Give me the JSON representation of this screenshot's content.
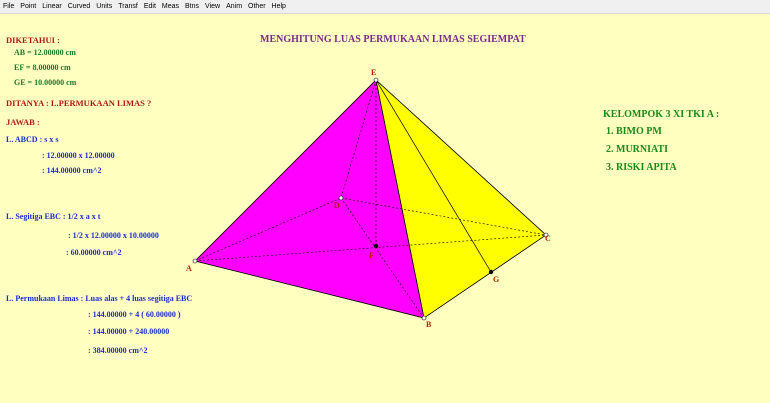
{
  "menu": [
    "File",
    "Point",
    "Linear",
    "Curved",
    "Units",
    "Transf",
    "Edit",
    "Meas",
    "Btns",
    "View",
    "Anim",
    "Other",
    "Help"
  ],
  "title": "MENGHITUNG LUAS PERMUKAAN LIMAS SEGIEMPAT",
  "diketahui": {
    "heading": "DIKETAHUI :",
    "ab": "AB = 12.00000  cm",
    "ef": "EF = 8.00000  cm",
    "ge": "GE = 10.00000  cm"
  },
  "ditanya": "DITANYA : L.PERMUKAAN LIMAS ?",
  "jawab": "JAWAB :",
  "abcd": {
    "label": "L. ABCD : s x s",
    "line1": ": 12.00000  x  12.00000",
    "line2": ": 144.00000  cm^2"
  },
  "ebc": {
    "label": "L. Segitiga EBC : 1/2 x a x t",
    "line1": ": 1/2 x  12.00000 x  10.00000",
    "line2": ": 60.00000  cm^2"
  },
  "surface": {
    "label": "L. Permukaan Limas : Luas alas + 4 luas segitiga EBC",
    "line1": ":  144.00000  +  4 ( 60.00000 )",
    "line2": ":  144.00000  +  240.00000",
    "line3": ":  384.00000   cm^2"
  },
  "group": {
    "heading": "KELOMPOK 3 XI TKI A :",
    "members": [
      "1. BIMO PM",
      "2. MURNIATI",
      "3. RISKI APITA"
    ]
  },
  "vertices": {
    "a": "A",
    "b": "B",
    "c": "C",
    "d": "D",
    "e": "E",
    "f": "F",
    "g": "G"
  },
  "colors": {
    "background": "#ffffc0",
    "face_magenta": "#ff00ff",
    "face_yellow": "#ffff00"
  }
}
